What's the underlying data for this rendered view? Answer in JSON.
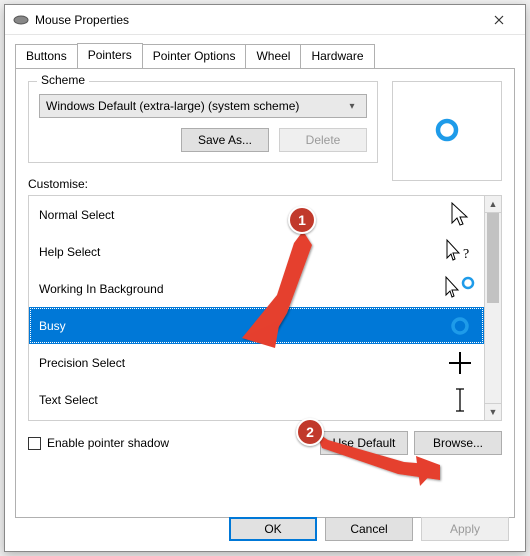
{
  "window": {
    "title": "Mouse Properties",
    "icon": "mouse-icon"
  },
  "tabs": [
    "Buttons",
    "Pointers",
    "Pointer Options",
    "Wheel",
    "Hardware"
  ],
  "active_tab": "Pointers",
  "scheme": {
    "legend": "Scheme",
    "selected": "Windows Default (extra-large) (system scheme)",
    "buttons": {
      "save_as": "Save As...",
      "delete": "Delete"
    }
  },
  "customise_label": "Customise:",
  "pointer_items": [
    {
      "label": "Normal Select",
      "selected": false
    },
    {
      "label": "Help Select",
      "selected": false
    },
    {
      "label": "Working In Background",
      "selected": false
    },
    {
      "label": "Busy",
      "selected": true
    },
    {
      "label": "Precision Select",
      "selected": false
    },
    {
      "label": "Text Select",
      "selected": false
    }
  ],
  "shadow": {
    "checked": false,
    "label": "Enable pointer shadow"
  },
  "list_buttons": {
    "use_default": "Use Default",
    "browse": "Browse..."
  },
  "footer": {
    "ok": "OK",
    "cancel": "Cancel",
    "apply": "Apply"
  },
  "annotations": {
    "one": "1",
    "two": "2"
  },
  "colors": {
    "selection": "#0078d7",
    "red": "#c1392b",
    "busy_ring": "#1e9be9"
  }
}
